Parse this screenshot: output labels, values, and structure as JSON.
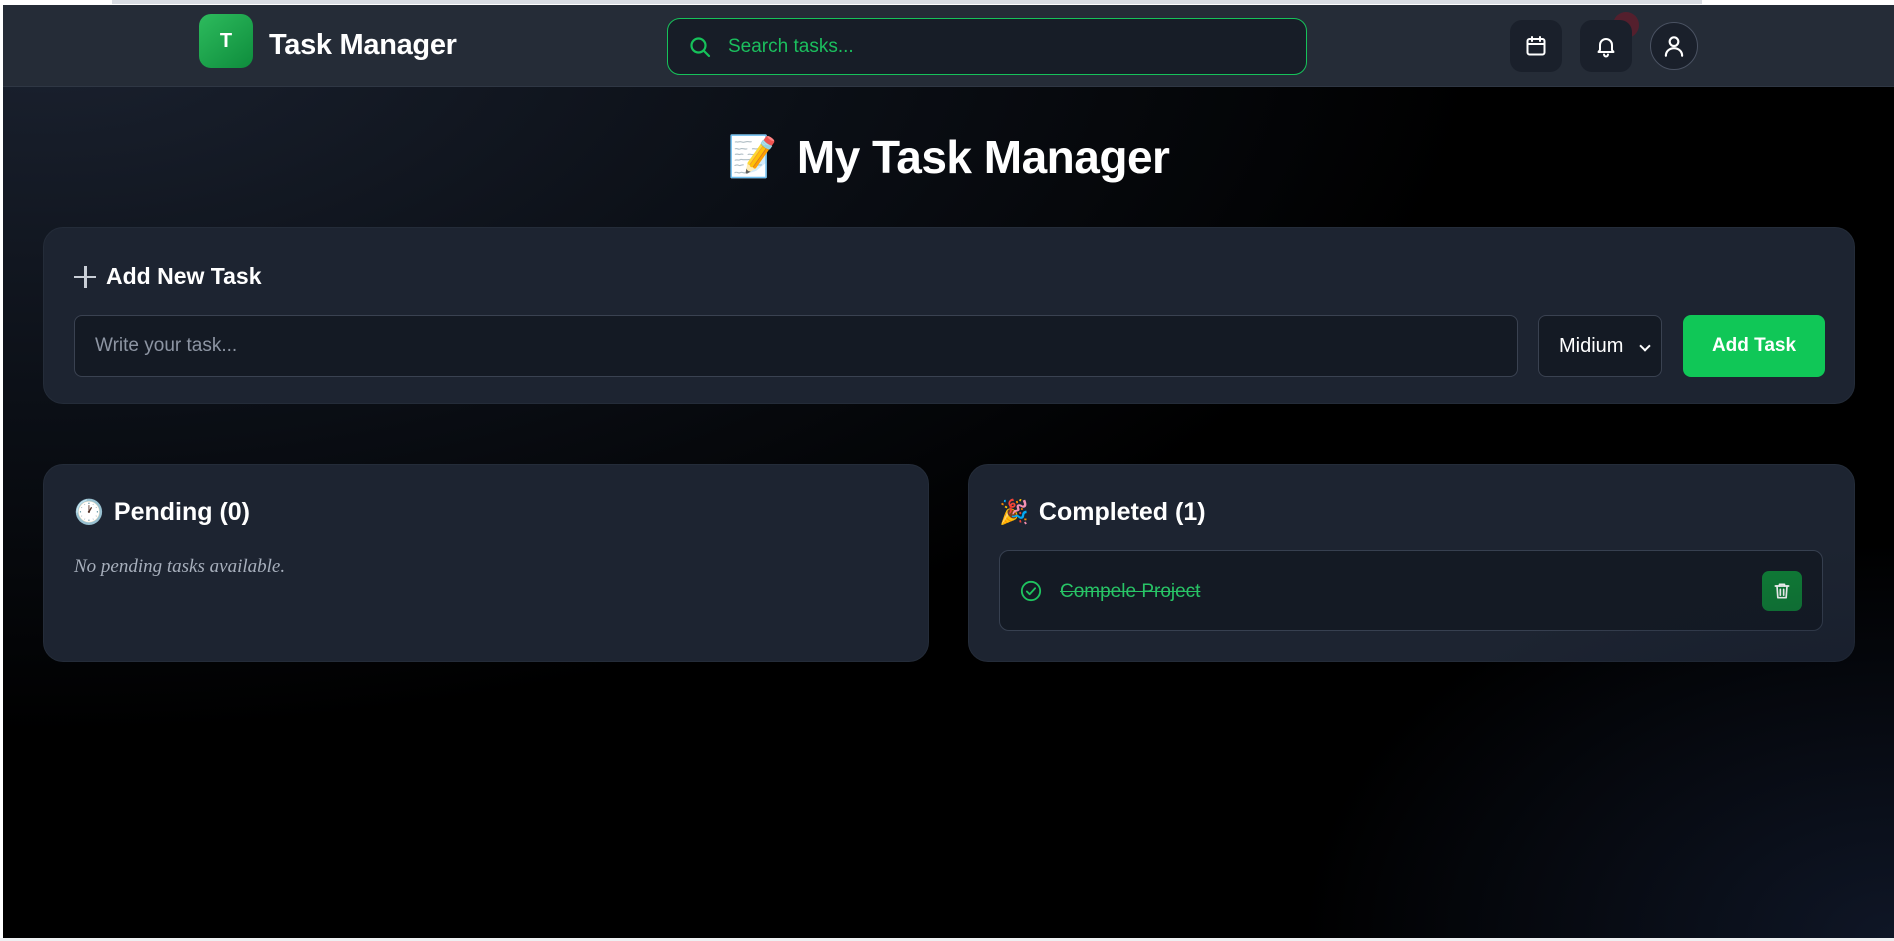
{
  "header": {
    "logo_letter": "T",
    "app_name": "Task Manager",
    "search_placeholder": "Search tasks...",
    "icons": [
      "calendar-icon",
      "bell-icon",
      "user-icon"
    ]
  },
  "page": {
    "title_emoji": "📝",
    "title": "My Task Manager"
  },
  "add_task": {
    "heading": "Add New Task",
    "input_placeholder": "Write your task...",
    "priority_selected": "Midium",
    "button_label": "Add Task"
  },
  "pending": {
    "emoji": "🕐",
    "heading": "Pending (0)",
    "empty_text": "No pending tasks available."
  },
  "completed": {
    "emoji": "🎉",
    "heading": "Completed (1)",
    "items": [
      {
        "label": "Compele Project"
      }
    ]
  },
  "colors": {
    "accent": "#10c757",
    "panel": "#1d2431",
    "header": "#252c37"
  }
}
